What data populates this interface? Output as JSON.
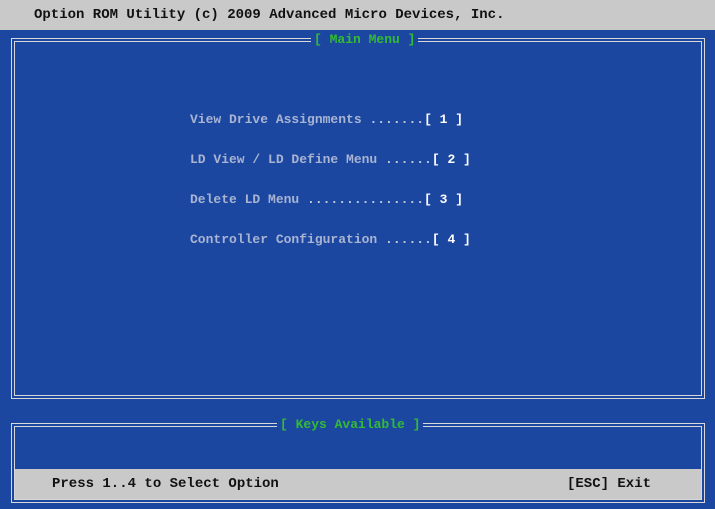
{
  "title_bar": {
    "text": "Option ROM Utility (c) 2009 Advanced Micro Devices, Inc."
  },
  "main_menu": {
    "title": "[ Main Menu ]",
    "items": [
      {
        "label": "View Drive Assignments",
        "dots": " .......",
        "key": "[ 1 ]"
      },
      {
        "label": "LD View / LD Define Menu",
        "dots": " ......",
        "key": "[ 2 ]"
      },
      {
        "label": "Delete LD Menu",
        "dots": " ...............",
        "key": "[ 3 ]"
      },
      {
        "label": "Controller Configuration",
        "dots": " ......",
        "key": "[ 4 ]"
      }
    ]
  },
  "keys_panel": {
    "title": "[ Keys Available ]",
    "hint": "Press 1..4 to Select Option",
    "exit": "[ESC] Exit"
  },
  "colors": {
    "background": "#1c47a0",
    "bar": "#c9c9c9",
    "frame_title": "#33bb33",
    "menu_text": "#a8b4d2"
  }
}
